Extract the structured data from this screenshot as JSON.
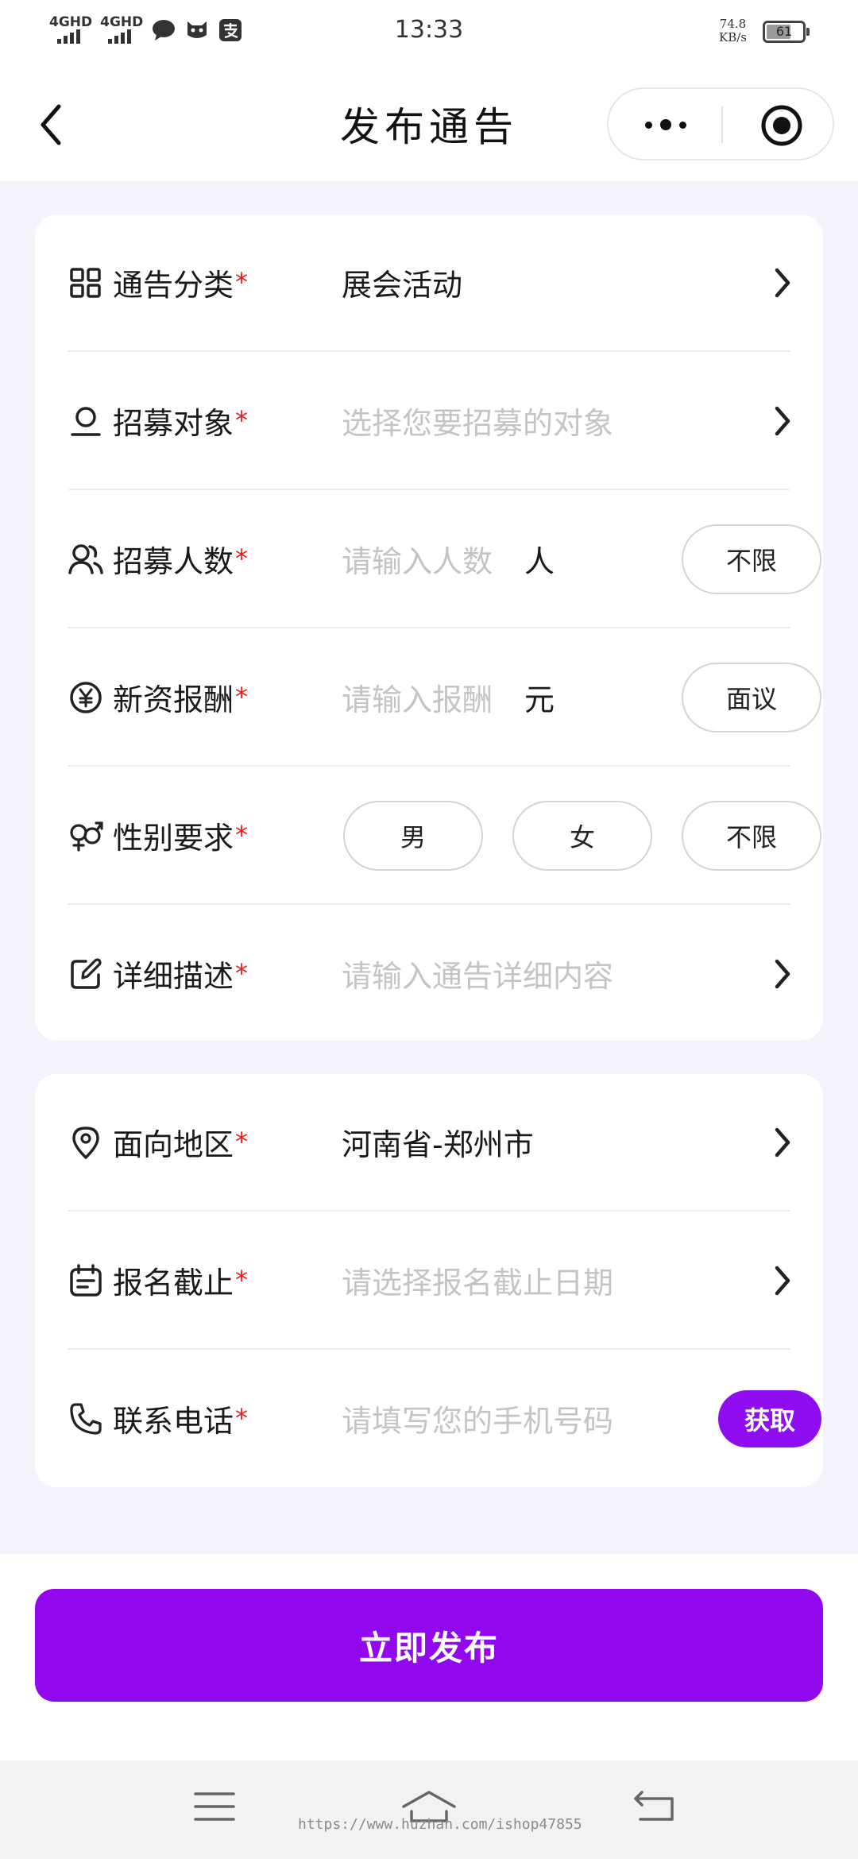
{
  "status_bar": {
    "network1": "4GHD",
    "network2": "4GHD",
    "time": "13:33",
    "speed_value": "74.8",
    "speed_unit": "KB/s",
    "battery": "61"
  },
  "nav": {
    "title": "发布通告",
    "back_icon": "chevron-left-icon",
    "more_icon": "more-dots-icon",
    "close_icon": "target-circle-icon"
  },
  "form": {
    "required_mark": "*",
    "category": {
      "label": "通告分类",
      "value": "展会活动",
      "icon": "grid-icon"
    },
    "recruit_target": {
      "label": "招募对象",
      "placeholder": "选择您要招募的对象",
      "icon": "user-icon"
    },
    "recruit_count": {
      "label": "招募人数",
      "placeholder": "请输入人数",
      "unit": "人",
      "option": "不限",
      "icon": "users-icon"
    },
    "salary": {
      "label": "新资报酬",
      "placeholder": "请输入报酬",
      "unit": "元",
      "option": "面议",
      "icon": "yen-icon"
    },
    "gender": {
      "label": "性别要求",
      "options": [
        "男",
        "女",
        "不限"
      ],
      "icon": "gender-icon"
    },
    "description": {
      "label": "详细描述",
      "placeholder": "请输入通告详细内容",
      "icon": "edit-icon"
    },
    "region": {
      "label": "面向地区",
      "value": "河南省-郑州市",
      "icon": "location-icon"
    },
    "deadline": {
      "label": "报名截止",
      "placeholder": "请选择报名截止日期",
      "icon": "calendar-icon"
    },
    "phone": {
      "label": "联系电话",
      "placeholder": "请填写您的手机号码",
      "button": "获取",
      "icon": "phone-icon"
    }
  },
  "publish_button": "立即发布",
  "system_nav": {
    "watermark": "https://www.huzhan.com/ishop47855"
  },
  "colors": {
    "accent": "#9108ef",
    "required": "#e02020",
    "placeholder": "#c4c4c4",
    "page_bg": "#f4f2fa"
  }
}
